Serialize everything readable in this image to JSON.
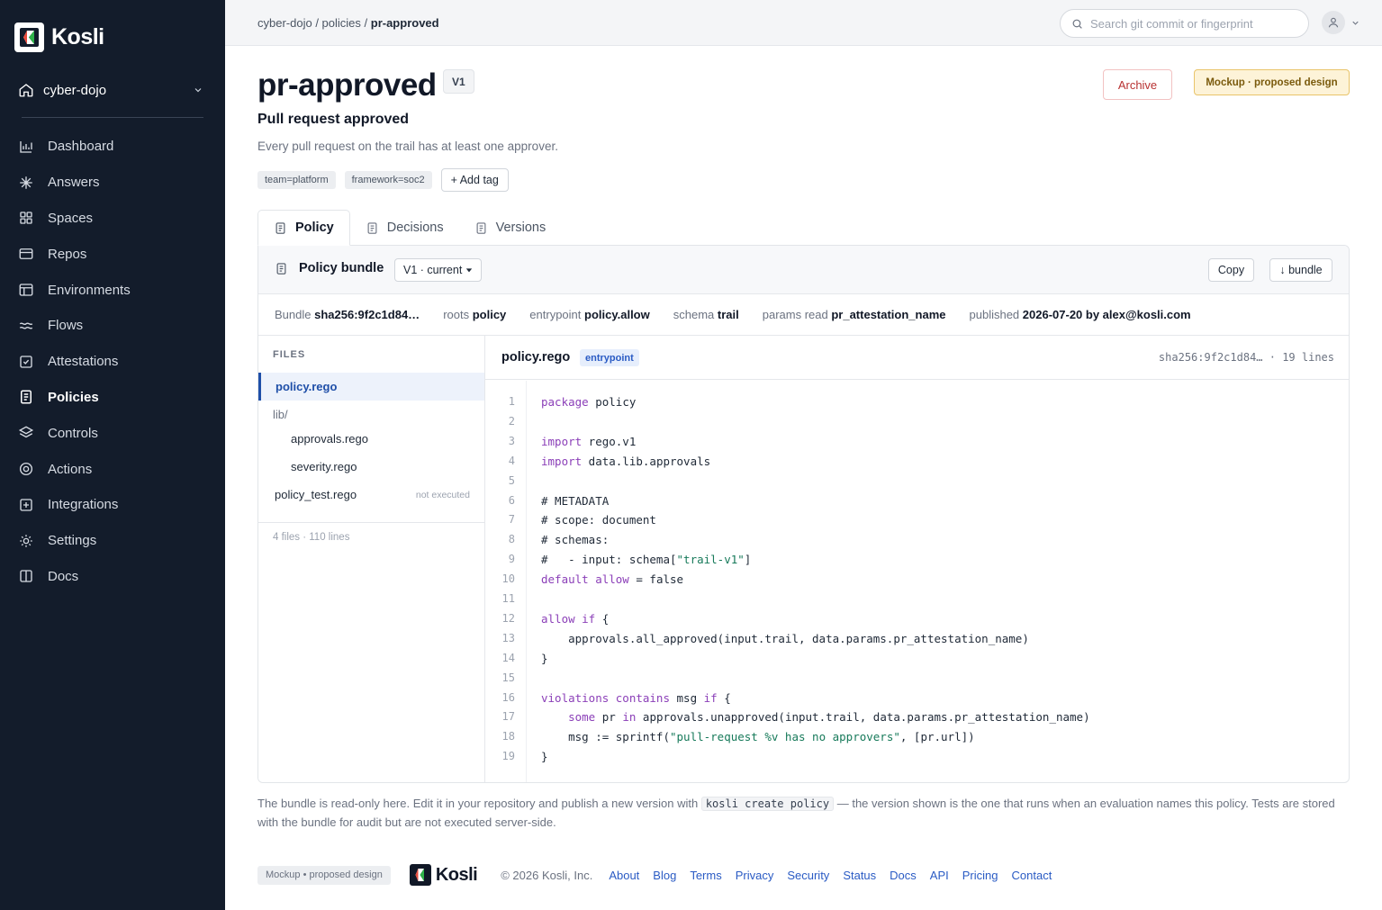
{
  "brand": {
    "name": "Kosli"
  },
  "sidebar": {
    "org": "cyber-dojo",
    "items": [
      {
        "label": "Dashboard",
        "icon": "bar-chart-icon"
      },
      {
        "label": "Answers",
        "icon": "sparkle-icon"
      },
      {
        "label": "Spaces",
        "icon": "grid-icon"
      },
      {
        "label": "Repos",
        "icon": "folder-icon"
      },
      {
        "label": "Environments",
        "icon": "layout-icon"
      },
      {
        "label": "Flows",
        "icon": "waves-icon"
      },
      {
        "label": "Attestations",
        "icon": "check-square-icon"
      },
      {
        "label": "Policies",
        "icon": "document-icon",
        "active": true
      },
      {
        "label": "Controls",
        "icon": "layers-icon"
      },
      {
        "label": "Actions",
        "icon": "target-icon"
      },
      {
        "label": "Integrations",
        "icon": "plus-square-icon"
      },
      {
        "label": "Settings",
        "icon": "sun-gear-icon"
      },
      {
        "label": "Docs",
        "icon": "book-icon"
      }
    ]
  },
  "topbar": {
    "breadcrumb": [
      "cyber-dojo",
      "policies",
      "pr-approved"
    ],
    "search_placeholder": "Search git commit or fingerprint"
  },
  "policy": {
    "name": "pr-approved",
    "version_badge": "V1",
    "title": "Pull request approved",
    "description": "Every pull request on the trail has at least one approver.",
    "tags": [
      "team=platform",
      "framework=soc2"
    ],
    "add_tag_label": "+ Add tag",
    "archive_label": "Archive",
    "mockup_badge": "Mockup · proposed design"
  },
  "tabs": [
    {
      "label": "Policy",
      "active": true
    },
    {
      "label": "Decisions"
    },
    {
      "label": "Versions"
    }
  ],
  "bundle": {
    "title": "Policy bundle",
    "version_select": "V1 · current",
    "copy_label": "Copy",
    "download_label": "↓ bundle",
    "meta": [
      {
        "label": "Bundle",
        "value": "sha256:9f2c1d84…"
      },
      {
        "label": "roots",
        "value": "policy"
      },
      {
        "label": "entrypoint",
        "value": "policy.allow"
      },
      {
        "label": "schema",
        "value": "trail"
      },
      {
        "label": "params read",
        "value": "pr_attestation_name"
      },
      {
        "label": "published",
        "value": "2026-07-20 by alex@kosli.com"
      }
    ],
    "files_header": "FILES",
    "files": {
      "f1": "policy.rego",
      "folder": "lib/",
      "f2": "approvals.rego",
      "f3": "severity.rego",
      "f4": "policy_test.rego",
      "f4_note": "not executed"
    },
    "files_count": "4 files · 110 lines",
    "code_file": "policy.rego",
    "entry_badge": "entrypoint",
    "code_meta": "sha256:9f2c1d84… · 19 lines",
    "code_lines": [
      "<span class=\"kw\">package</span> policy",
      "",
      "<span class=\"kw\">import</span> rego.v1",
      "<span class=\"kw\">import</span> data.lib.approvals",
      "",
      "# METADATA",
      "# scope: document",
      "# schemas:",
      "#   - input: schema[<span class=\"st\">\"trail-v1\"</span>]",
      "<span class=\"kw\">default allow</span> = false",
      "",
      "<span class=\"kw\">allow if</span> {",
      "    approvals.all_approved(input.trail, data.params.pr_attestation_name)",
      "}",
      "",
      "<span class=\"kw\">violations contains</span> msg <span class=\"kw\">if</span> {",
      "    <span class=\"kw\">some</span> pr <span class=\"kw\">in</span> approvals.unapproved(input.trail, data.params.pr_attestation_name)",
      "    msg := sprintf(<span class=\"st\">\"pull-request %v has no approvers\"</span>, [pr.url])",
      "}"
    ]
  },
  "footnote": {
    "before": "The bundle is read-only here. Edit it in your repository and publish a new version with ",
    "code": "kosli create policy",
    "after": " — the version shown is the one that runs when an evaluation names this policy. Tests are stored with the bundle for audit but are not executed server-side."
  },
  "footer": {
    "mockup": "Mockup • proposed design",
    "brand": "Kosli",
    "copyright": "© 2026 Kosli, Inc.",
    "links": [
      "About",
      "Blog",
      "Terms",
      "Privacy",
      "Security",
      "Status",
      "Docs",
      "API",
      "Pricing",
      "Contact"
    ]
  }
}
